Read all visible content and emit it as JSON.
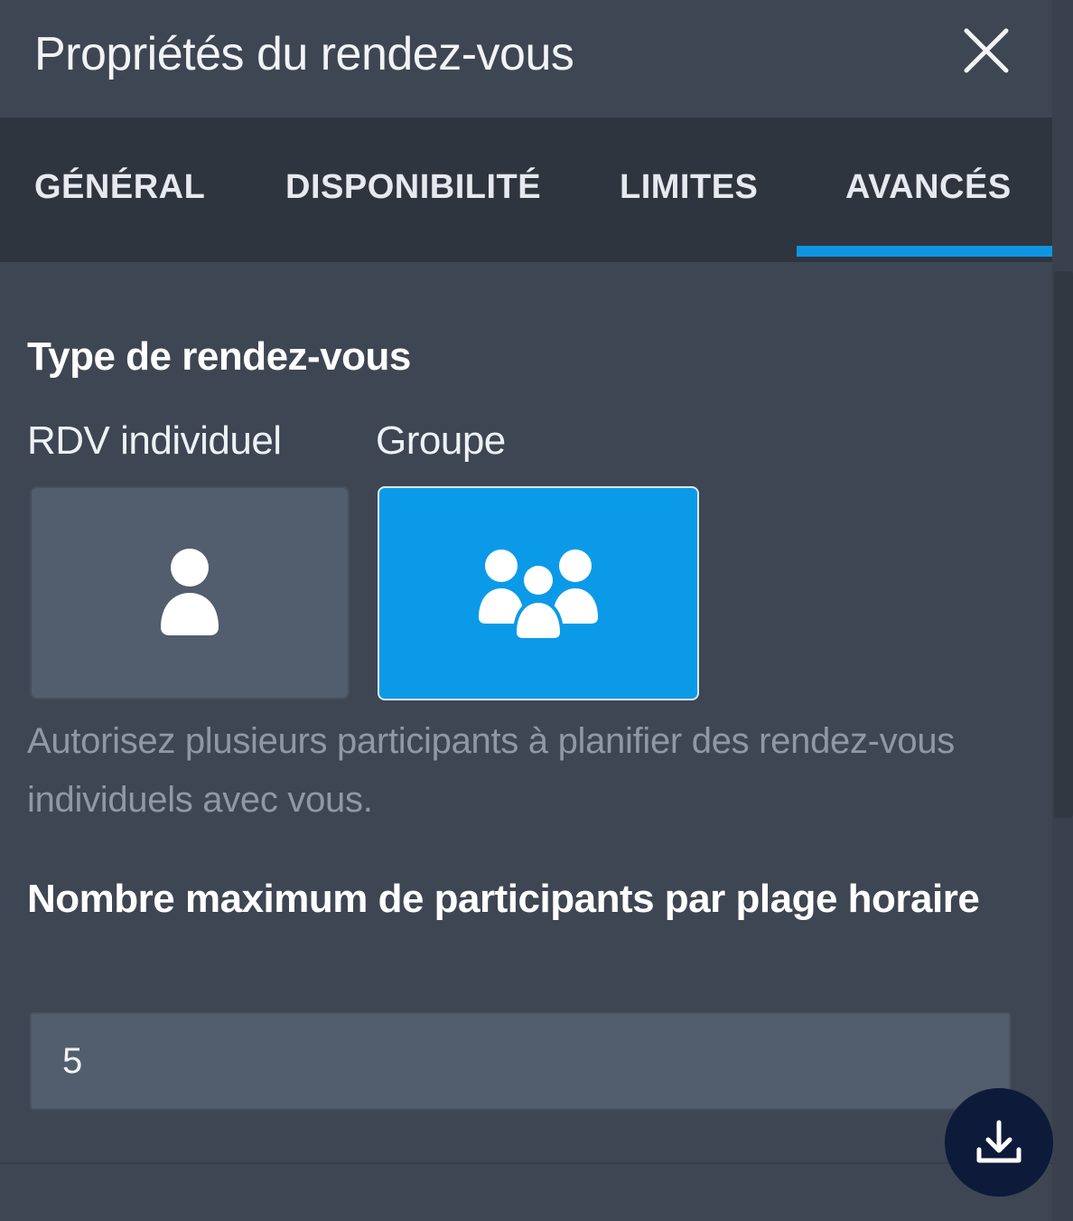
{
  "header": {
    "title": "Propriétés du rendez-vous",
    "close_icon": "close-icon"
  },
  "tabs": [
    {
      "label": "GÉNÉRAL",
      "active": false
    },
    {
      "label": "DISPONIBILITÉ",
      "active": false
    },
    {
      "label": "LIMITES",
      "active": false
    },
    {
      "label": "AVANCÉS",
      "active": true
    }
  ],
  "appointment_type": {
    "title": "Type de rendez-vous",
    "options": [
      {
        "label": "RDV individuel",
        "icon": "single-user-icon",
        "selected": false
      },
      {
        "label": "Groupe",
        "icon": "group-users-icon",
        "selected": true
      }
    ],
    "help_text": "Autorisez plusieurs participants à planifier des rendez-vous individuels avec vous."
  },
  "max_participants": {
    "title": "Nombre maximum de participants par plage horaire",
    "value": "5"
  },
  "fab": {
    "icon": "download-icon"
  },
  "colors": {
    "panel_bg": "#3e4653",
    "tabs_bg": "#2f353f",
    "accent": "#0b9ae8",
    "card_inactive": "#525d6d",
    "fab_bg": "#0e1a3a"
  }
}
